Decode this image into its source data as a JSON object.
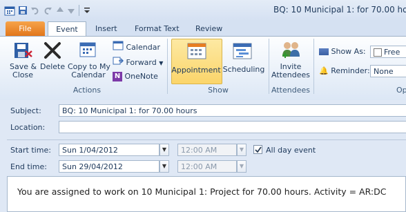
{
  "window": {
    "title": "BQ: 10 Municipal 1: for 70.00 hours"
  },
  "tabs": [
    {
      "label": "File"
    },
    {
      "label": "Event"
    },
    {
      "label": "Insert"
    },
    {
      "label": "Format Text"
    },
    {
      "label": "Review"
    }
  ],
  "ribbon": {
    "actions": {
      "save_close": "Save &\nClose",
      "delete": "Delete",
      "copy_calendar": "Copy to My\nCalendar",
      "calendar": "Calendar",
      "forward": "Forward",
      "onenote": "OneNote",
      "group_label": "Actions"
    },
    "show": {
      "appointment": "Appointment",
      "scheduling": "Scheduling",
      "group_label": "Show"
    },
    "attendees": {
      "invite": "Invite\nAttendees",
      "group_label": "Attendees"
    },
    "options": {
      "show_as_label": "Show As:",
      "show_as_value": "Free",
      "reminder_label": "Reminder:",
      "reminder_value": "None",
      "group_label_partial": "Op"
    }
  },
  "form": {
    "subject_label": "Subject:",
    "subject_value": "BQ: 10 Municipal 1: for 70.00 hours",
    "location_label": "Location:",
    "location_value": "",
    "start_label": "Start time:",
    "start_date": "Sun 1/04/2012",
    "start_time": "12:00 AM",
    "end_label": "End time:",
    "end_date": "Sun 29/04/2012",
    "end_time": "12:00 AM",
    "all_day_label": "All day event",
    "all_day_checked": true,
    "body": "You are assigned to work on 10 Municipal 1: Project for 70.00 hours. Activity = AR:DC"
  },
  "colors": {
    "file_tab": "#e2761b",
    "selected_button": "#fbd56a",
    "accent": "#1e395b"
  }
}
